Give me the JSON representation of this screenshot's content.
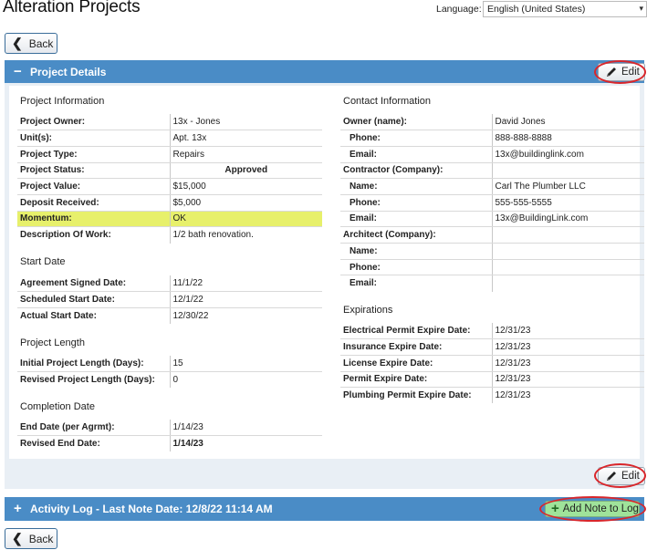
{
  "header": {
    "title": "Alteration Projects",
    "language_label": "Language:",
    "language_value": "English (United States)"
  },
  "buttons": {
    "back": "Back",
    "edit": "Edit",
    "add_note": "Add Note to Log"
  },
  "project_details": {
    "header": "Project Details",
    "toggle": "−",
    "project_information": {
      "title": "Project Information",
      "rows": [
        {
          "label": "Project Owner:",
          "value": "13x - Jones"
        },
        {
          "label": "Unit(s):",
          "value": "Apt. 13x"
        },
        {
          "label": "Project Type:",
          "value": "Repairs"
        },
        {
          "label": "Project Status:",
          "value": "Approved"
        },
        {
          "label": "Project Value:",
          "value": "$15,000"
        },
        {
          "label": "Deposit Received:",
          "value": "$5,000"
        },
        {
          "label": "Momentum:",
          "value": "OK"
        },
        {
          "label": "Description Of Work:",
          "value": "1/2 bath renovation."
        }
      ]
    },
    "start_date": {
      "title": "Start Date",
      "rows": [
        {
          "label": "Agreement Signed Date:",
          "value": "11/1/22"
        },
        {
          "label": "Scheduled Start Date:",
          "value": "12/1/22"
        },
        {
          "label": "Actual Start Date:",
          "value": "12/30/22"
        }
      ]
    },
    "project_length": {
      "title": "Project Length",
      "rows": [
        {
          "label": "Initial Project Length (Days):",
          "value": "15"
        },
        {
          "label": "Revised Project Length (Days):",
          "value": "0"
        }
      ]
    },
    "completion_date": {
      "title": "Completion Date",
      "rows": [
        {
          "label": "End Date (per Agrmt):",
          "value": "1/14/23"
        },
        {
          "label": "Revised End Date:",
          "value": "1/14/23"
        }
      ]
    },
    "contact_information": {
      "title": "Contact Information",
      "rows": [
        {
          "label": "Owner (name):",
          "value": "David Jones"
        },
        {
          "label": "Phone:",
          "value": "888-888-8888"
        },
        {
          "label": "Email:",
          "value": "13x@buildinglink.com"
        },
        {
          "label": "Contractor (Company):",
          "value": ""
        },
        {
          "label": "Name:",
          "value": "Carl The Plumber LLC"
        },
        {
          "label": "Phone:",
          "value": "555-555-5555"
        },
        {
          "label": "Email:",
          "value": "13x@BuildingLink.com"
        },
        {
          "label": "Architect (Company):",
          "value": ""
        },
        {
          "label": "Name:",
          "value": ""
        },
        {
          "label": "Phone:",
          "value": ""
        },
        {
          "label": "Email:",
          "value": ""
        }
      ]
    },
    "expirations": {
      "title": "Expirations",
      "rows": [
        {
          "label": "Electrical Permit Expire Date:",
          "value": "12/31/23"
        },
        {
          "label": "Insurance Expire Date:",
          "value": "12/31/23"
        },
        {
          "label": "License Expire Date:",
          "value": "12/31/23"
        },
        {
          "label": "Permit Expire Date:",
          "value": "12/31/23"
        },
        {
          "label": "Plumbing Permit Expire Date:",
          "value": "12/31/23"
        }
      ]
    }
  },
  "activity_log": {
    "header": "Activity Log - Last Note Date: 12/8/22 11:14 AM",
    "toggle": "+"
  },
  "colors": {
    "panel_header": "#4a8cc6",
    "highlight": "#e7f06b",
    "annotation_ring": "#d9262b",
    "add_note_button": "#9fe39a"
  }
}
